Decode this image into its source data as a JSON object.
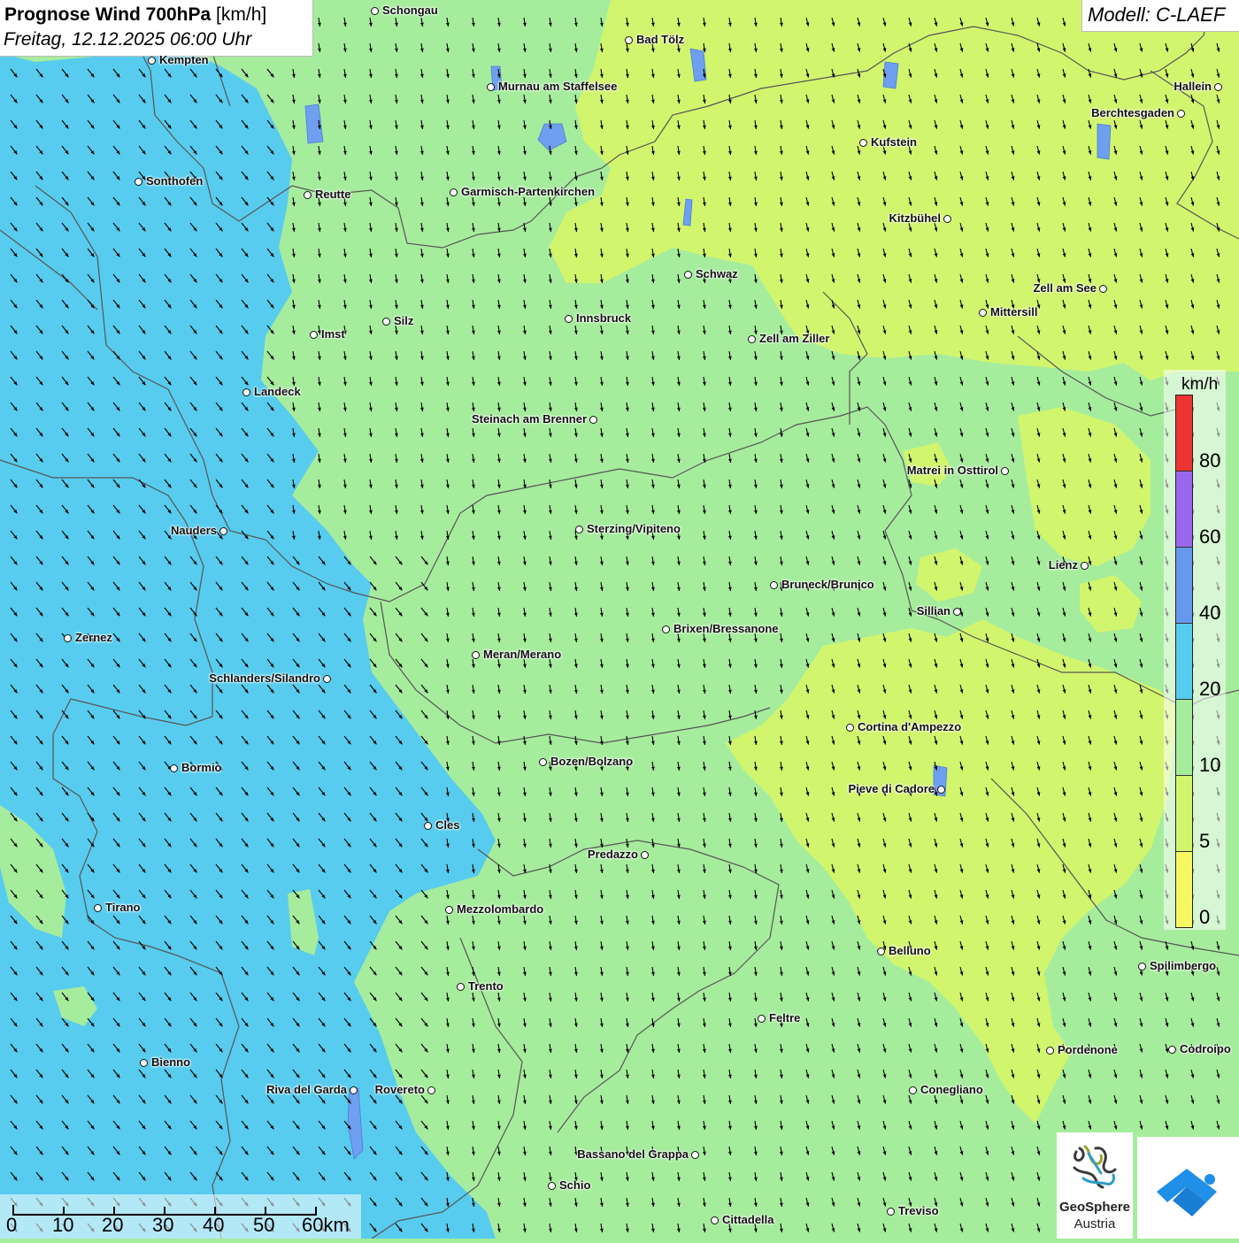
{
  "header": {
    "title_bold": "Prognose Wind 700hPa",
    "title_unit": " [km/h]",
    "subtitle": "Freitag, 12.12.2025 06:00 Uhr",
    "model": "Modell: C-LAEF"
  },
  "colors": {
    "wind_0_5": "#f7f764",
    "wind_5_10": "#d2f56e",
    "wind_10_20": "#a6ec9d",
    "wind_20_40": "#58ccee",
    "wind_40_60": "#6699ee",
    "wind_60_80": "#9966ee",
    "wind_80_plus": "#ee3333",
    "border": "#555555",
    "arrow": "#000000"
  },
  "legend": {
    "unit": "km/h",
    "labels": [
      "80",
      "60",
      "40",
      "20",
      "10",
      "5",
      "0"
    ]
  },
  "scalebar": {
    "labels": [
      "0",
      "10",
      "20",
      "30",
      "40",
      "50",
      "60km"
    ]
  },
  "cities": [
    {
      "name": "Schongau"
    },
    {
      "name": "Bad Tölz"
    },
    {
      "name": "Kempten"
    },
    {
      "name": "Murnau am Staffelsee"
    },
    {
      "name": "Hallein"
    },
    {
      "name": "Berchtesgaden"
    },
    {
      "name": "Kufstein"
    },
    {
      "name": "Sonthofen"
    },
    {
      "name": "Reutte"
    },
    {
      "name": "Garmisch-Partenkirchen"
    },
    {
      "name": "Kitzbühel"
    },
    {
      "name": "Schwaz"
    },
    {
      "name": "Zell am See"
    },
    {
      "name": "Innsbruck"
    },
    {
      "name": "Silz"
    },
    {
      "name": "Mittersill"
    },
    {
      "name": "Imst"
    },
    {
      "name": "Zell am Ziller"
    },
    {
      "name": "Landeck"
    },
    {
      "name": "Steinach am Brenner"
    },
    {
      "name": "Matrei in Osttirol"
    },
    {
      "name": "Nauders"
    },
    {
      "name": "Sterzing/Vipiteno"
    },
    {
      "name": "Lienz"
    },
    {
      "name": "Bruneck/Brunico"
    },
    {
      "name": "Sillian"
    },
    {
      "name": "Brixen/Bressanone"
    },
    {
      "name": "Zernez"
    },
    {
      "name": "Meran/Merano"
    },
    {
      "name": "Schlanders/Silandro"
    },
    {
      "name": "Cortina d'Ampezzo"
    },
    {
      "name": "Bozen/Bolzano"
    },
    {
      "name": "Bormio"
    },
    {
      "name": "Pieve di Cadore"
    },
    {
      "name": "Cles"
    },
    {
      "name": "Predazzo"
    },
    {
      "name": "Tirano"
    },
    {
      "name": "Mezzolombardo"
    },
    {
      "name": "Belluno"
    },
    {
      "name": "Spilimbergo"
    },
    {
      "name": "Trento"
    },
    {
      "name": "Feltre"
    },
    {
      "name": "Pordenone"
    },
    {
      "name": "Codroipo"
    },
    {
      "name": "Bienno"
    },
    {
      "name": "Riva del Garda"
    },
    {
      "name": "Rovereto"
    },
    {
      "name": "Conegliano"
    },
    {
      "name": "Bassano del Grappa"
    },
    {
      "name": "Schio"
    },
    {
      "name": "Treviso"
    },
    {
      "name": "Cittadella"
    }
  ],
  "logos": {
    "geosphere_line1": "GeoSphere",
    "geosphere_line2": "Austria"
  }
}
